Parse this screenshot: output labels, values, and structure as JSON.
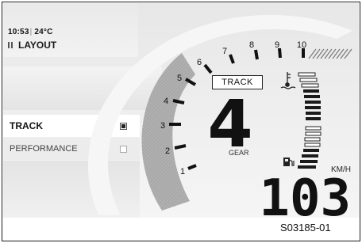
{
  "status": {
    "time": "10:53",
    "separator": "|",
    "temperature": "24°C"
  },
  "menu": {
    "title": "LAYOUT",
    "items": [
      {
        "label": "TRACK",
        "checked": true
      },
      {
        "label": "PERFORMANCE",
        "checked": false
      }
    ]
  },
  "tachometer": {
    "scale_labels": [
      "1",
      "2",
      "3",
      "4",
      "5",
      "6",
      "7",
      "8",
      "9",
      "10"
    ],
    "current_rpm_fraction": 0.5
  },
  "riding_mode": "TRACK",
  "gear": {
    "value": "4",
    "label": "GEAR"
  },
  "speed": {
    "value": "103",
    "unit": "KM/H"
  },
  "gauges": {
    "temperature_icon": "coolant-temperature-icon",
    "fuel_icon": "fuel-pump-icon"
  },
  "reference_code": "S03185-01",
  "colors": {
    "tacho_fill": "#a8a8a8",
    "digits": "#111111",
    "background": "#ececec"
  }
}
